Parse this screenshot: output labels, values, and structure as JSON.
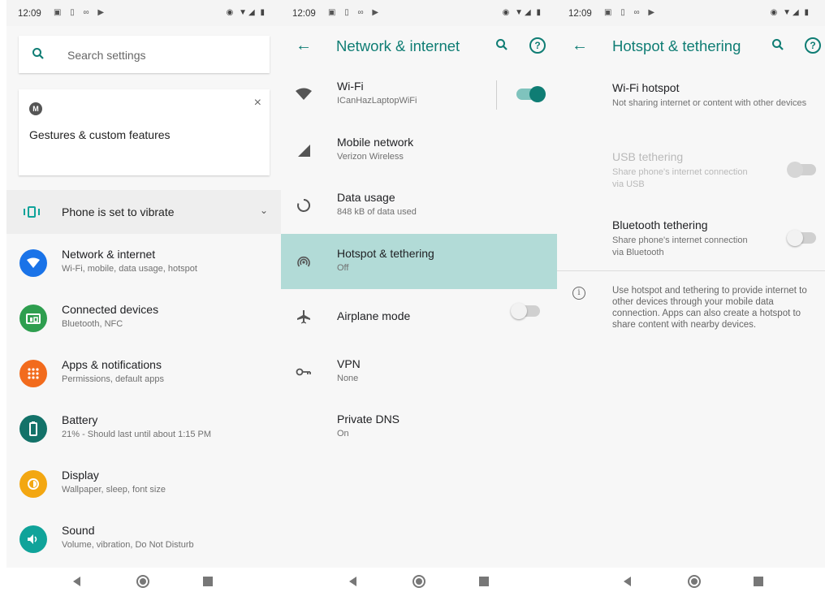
{
  "panels": {
    "settings": {
      "status": {
        "time": "12:09"
      },
      "search": {
        "placeholder": "Search settings"
      },
      "suggestion_card": {
        "title": "Gestures & custom features",
        "close": "×"
      },
      "vibrate_row": {
        "label": "Phone is set to vibrate"
      },
      "items": [
        {
          "title": "Network & internet",
          "subtitle": "Wi-Fi, mobile, data usage, hotspot",
          "icon": "wifi-icon",
          "color": "#1a73e8"
        },
        {
          "title": "Connected devices",
          "subtitle": "Bluetooth, NFC",
          "icon": "devices-icon",
          "color": "#2e9e4f"
        },
        {
          "title": "Apps & notifications",
          "subtitle": "Permissions, default apps",
          "icon": "apps-grid-icon",
          "color": "#f26b1d"
        },
        {
          "title": "Battery",
          "subtitle": "21% - Should last until about 1:15 PM",
          "icon": "battery-icon",
          "color": "#137269"
        },
        {
          "title": "Display",
          "subtitle": "Wallpaper, sleep, font size",
          "icon": "brightness-icon",
          "color": "#f3a712"
        },
        {
          "title": "Sound",
          "subtitle": "Volume, vibration, Do Not Disturb",
          "icon": "volume-icon",
          "color": "#10a39a"
        }
      ]
    },
    "network": {
      "status": {
        "time": "12:09"
      },
      "title": "Network & internet",
      "items": [
        {
          "title": "Wi-Fi",
          "subtitle": "ICanHazLaptopWiFi",
          "icon": "wifi-icon",
          "toggle": "on"
        },
        {
          "title": "Mobile network",
          "subtitle": "Verizon Wireless",
          "icon": "signal-icon"
        },
        {
          "title": "Data usage",
          "subtitle": "848 kB of data used",
          "icon": "data-usage-icon"
        },
        {
          "title": "Hotspot & tethering",
          "subtitle": "Off",
          "icon": "hotspot-icon",
          "selected": true
        },
        {
          "title": "Airplane mode",
          "subtitle": "",
          "icon": "airplane-icon",
          "toggle": "off"
        },
        {
          "title": "VPN",
          "subtitle": "None",
          "icon": "vpn-key-icon"
        },
        {
          "title": "Private DNS",
          "subtitle": "On",
          "icon": ""
        }
      ]
    },
    "hotspot": {
      "status": {
        "time": "12:09"
      },
      "title": "Hotspot & tethering",
      "items": [
        {
          "title": "Wi-Fi hotspot",
          "subtitle": "Not sharing internet or content with other devices"
        },
        {
          "title": "USB tethering",
          "subtitle": "Share phone's internet connection via USB",
          "disabled": true,
          "toggle": "off"
        },
        {
          "title": "Bluetooth tethering",
          "subtitle": "Share phone's internet connection via Bluetooth",
          "toggle": "off"
        }
      ],
      "info": "Use hotspot and tethering to provide internet to other devices through your mobile data connection. Apps can also create a hotspot to share content with nearby devices."
    }
  },
  "colors": {
    "accent": "#0f7d74",
    "selected_row": "#b2dbd7",
    "background": "#f7f7f7"
  }
}
